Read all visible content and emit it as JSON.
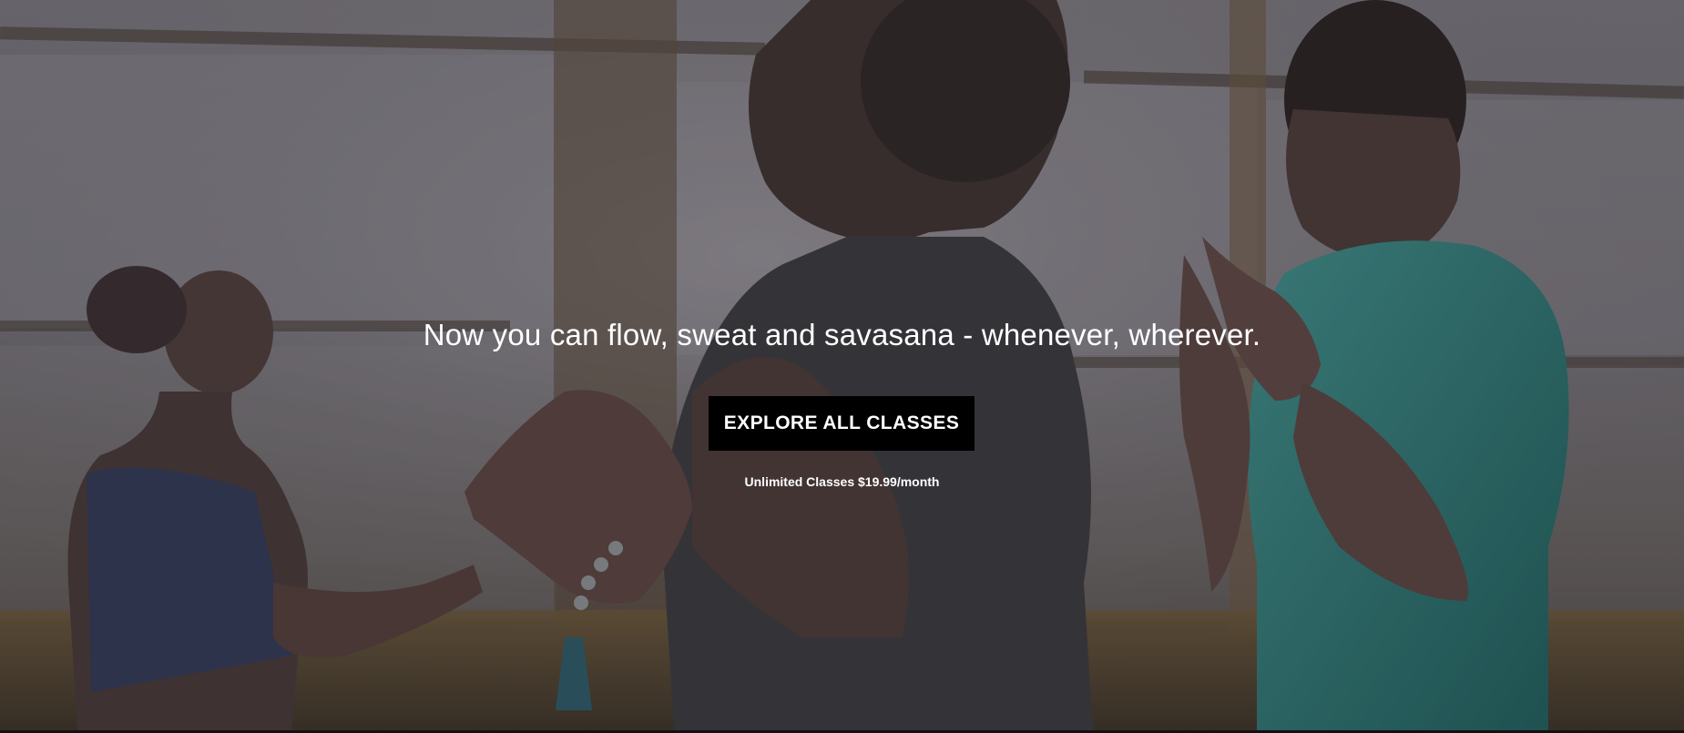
{
  "hero": {
    "headline": "Now you can flow, sweat and savasana - whenever, wherever.",
    "cta_label": "EXPLORE ALL CLASSES",
    "price_note": "Unlimited Classes $19.99/month",
    "background_image": "yoga-class-photo",
    "colors": {
      "button_bg": "#000000",
      "text": "#ffffff",
      "overlay": "#3c3a40"
    }
  }
}
